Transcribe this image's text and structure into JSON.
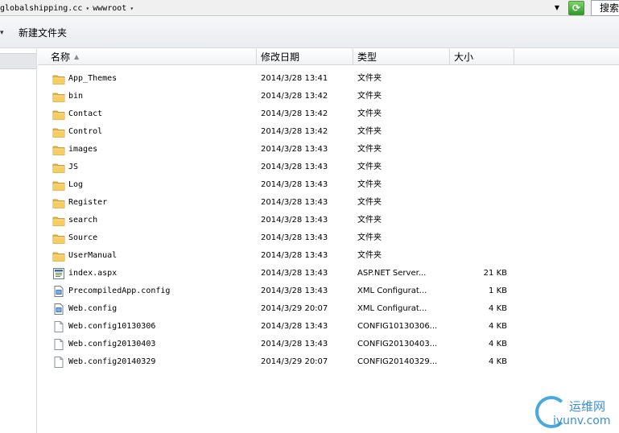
{
  "address_bar": {
    "crumbs": [
      "globalshipping.cc",
      "wwwroot"
    ],
    "separator": "▾",
    "search_text": "搜索"
  },
  "toolbar": {
    "new_folder_label": "新建文件夹"
  },
  "columns": {
    "name": "名称",
    "date": "修改日期",
    "type": "类型",
    "size": "大小"
  },
  "files": [
    {
      "name": "App_Themes",
      "date": "2014/3/28 13:41",
      "type": "文件夹",
      "size": "",
      "icon": "folder-icon"
    },
    {
      "name": "bin",
      "date": "2014/3/28 13:42",
      "type": "文件夹",
      "size": "",
      "icon": "folder-icon"
    },
    {
      "name": "Contact",
      "date": "2014/3/28 13:42",
      "type": "文件夹",
      "size": "",
      "icon": "folder-icon"
    },
    {
      "name": "Control",
      "date": "2014/3/28 13:42",
      "type": "文件夹",
      "size": "",
      "icon": "folder-icon"
    },
    {
      "name": "images",
      "date": "2014/3/28 13:43",
      "type": "文件夹",
      "size": "",
      "icon": "folder-icon"
    },
    {
      "name": "JS",
      "date": "2014/3/28 13:43",
      "type": "文件夹",
      "size": "",
      "icon": "folder-icon"
    },
    {
      "name": "Log",
      "date": "2014/3/28 13:43",
      "type": "文件夹",
      "size": "",
      "icon": "folder-icon"
    },
    {
      "name": "Register",
      "date": "2014/3/28 13:43",
      "type": "文件夹",
      "size": "",
      "icon": "folder-icon"
    },
    {
      "name": "search",
      "date": "2014/3/28 13:43",
      "type": "文件夹",
      "size": "",
      "icon": "folder-icon"
    },
    {
      "name": "Source",
      "date": "2014/3/28 13:43",
      "type": "文件夹",
      "size": "",
      "icon": "folder-icon"
    },
    {
      "name": "UserManual",
      "date": "2014/3/28 13:43",
      "type": "文件夹",
      "size": "",
      "icon": "folder-icon"
    },
    {
      "name": "index.aspx",
      "date": "2014/3/28 13:43",
      "type": "ASP.NET Server...",
      "size": "21 KB",
      "icon": "aspx-file-icon"
    },
    {
      "name": "PrecompiledApp.config",
      "date": "2014/3/28 13:43",
      "type": "XML Configurat...",
      "size": "1 KB",
      "icon": "config-file-icon"
    },
    {
      "name": "Web.config",
      "date": "2014/3/29 20:07",
      "type": "XML Configurat...",
      "size": "4 KB",
      "icon": "config-file-icon"
    },
    {
      "name": "Web.config10130306",
      "date": "2014/3/28 13:43",
      "type": "CONFIG10130306...",
      "size": "4 KB",
      "icon": "blank-file-icon"
    },
    {
      "name": "Web.config20130403",
      "date": "2014/3/28 13:43",
      "type": "CONFIG20130403...",
      "size": "4 KB",
      "icon": "blank-file-icon"
    },
    {
      "name": "Web.config20140329",
      "date": "2014/3/29 20:07",
      "type": "CONFIG20140329...",
      "size": "4 KB",
      "icon": "blank-file-icon"
    }
  ],
  "watermark": {
    "cn": "运维网",
    "en": "iyunv.com"
  }
}
